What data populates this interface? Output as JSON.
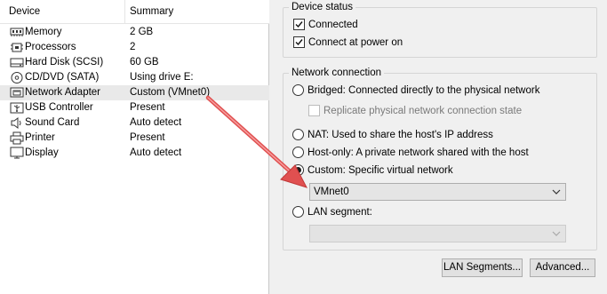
{
  "device_list": {
    "header": {
      "device": "Device",
      "summary": "Summary"
    },
    "rows": [
      {
        "name": "Memory",
        "summary": "2 GB",
        "icon": "memory-icon"
      },
      {
        "name": "Processors",
        "summary": "2",
        "icon": "processor-icon"
      },
      {
        "name": "Hard Disk (SCSI)",
        "summary": "60 GB",
        "icon": "hard-disk-icon"
      },
      {
        "name": "CD/DVD (SATA)",
        "summary": "Using drive E:",
        "icon": "cd-dvd-icon"
      },
      {
        "name": "Network Adapter",
        "summary": "Custom (VMnet0)",
        "icon": "network-adapter-icon",
        "selected": true
      },
      {
        "name": "USB Controller",
        "summary": "Present",
        "icon": "usb-icon"
      },
      {
        "name": "Sound Card",
        "summary": "Auto detect",
        "icon": "sound-icon"
      },
      {
        "name": "Printer",
        "summary": "Present",
        "icon": "printer-icon"
      },
      {
        "name": "Display",
        "summary": "Auto detect",
        "icon": "display-icon"
      }
    ]
  },
  "device_status": {
    "title": "Device status",
    "connected": {
      "label": "Connected",
      "checked": true
    },
    "connect_at_power_on": {
      "label": "Connect at power on",
      "checked": true
    }
  },
  "network_connection": {
    "title": "Network connection",
    "bridged": {
      "label": "Bridged: Connected directly to the physical network",
      "checked": false
    },
    "replicate": {
      "label": "Replicate physical network connection state",
      "checked": false,
      "enabled": false
    },
    "nat": {
      "label": "NAT: Used to share the host's IP address",
      "checked": false
    },
    "host_only": {
      "label": "Host-only: A private network shared with the host",
      "checked": false
    },
    "custom": {
      "label": "Custom: Specific virtual network",
      "checked": true
    },
    "custom_network_value": "VMnet0",
    "lan_segment": {
      "label": "LAN segment:",
      "checked": false
    },
    "lan_segment_value": ""
  },
  "buttons": {
    "lan_segments": "LAN Segments...",
    "advanced": "Advanced..."
  },
  "colors": {
    "selection": "#e9e9e9",
    "annotation_arrow": "#e05050"
  }
}
